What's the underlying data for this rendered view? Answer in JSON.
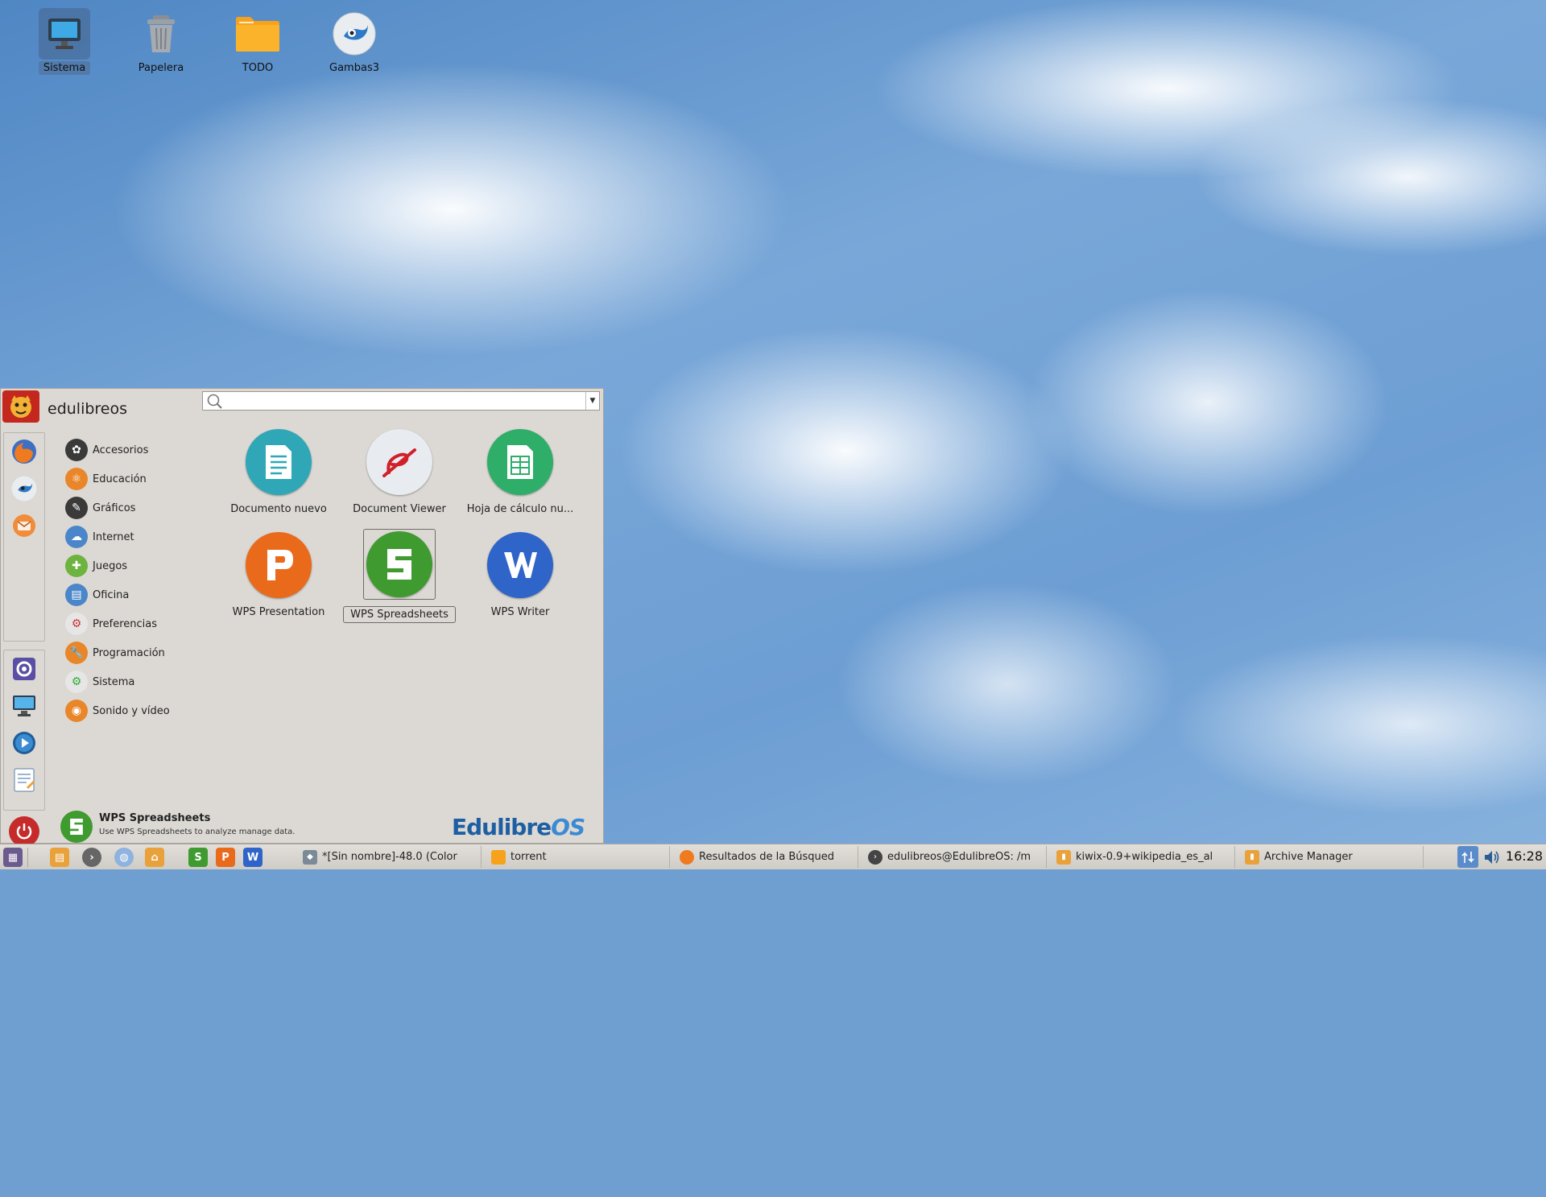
{
  "desktop": {
    "icons": [
      {
        "label": "Sistema",
        "icon": "computer-icon"
      },
      {
        "label": "Papelera",
        "icon": "trash-icon"
      },
      {
        "label": "TODO",
        "icon": "folder-icon"
      },
      {
        "label": "Gambas3",
        "icon": "gambas-icon"
      }
    ]
  },
  "menu": {
    "user": "edulibreos",
    "search": {
      "value": "",
      "placeholder": ""
    },
    "categories": [
      {
        "label": "Accesorios",
        "color": "#3a3a3a"
      },
      {
        "label": "Educación",
        "color": "#e9862a"
      },
      {
        "label": "Gráficos",
        "color": "#3a3a3a"
      },
      {
        "label": "Internet",
        "color": "#4a86c9"
      },
      {
        "label": "Juegos",
        "color": "#6cb33f"
      },
      {
        "label": "Oficina",
        "color": "#4a86c9"
      },
      {
        "label": "Preferencias",
        "color": "#e6e6e6"
      },
      {
        "label": "Programación",
        "color": "#e9862a"
      },
      {
        "label": "Sistema",
        "color": "#e6e6e6"
      },
      {
        "label": "Sonido y vídeo",
        "color": "#e9862a"
      }
    ],
    "apps": [
      {
        "label": "Documento nuevo",
        "color": "#2fa7b7",
        "icon": "document-icon"
      },
      {
        "label": "Document Viewer",
        "color": "#e8ecf1",
        "icon": "evince-icon"
      },
      {
        "label": "Hoja de cálculo nu...",
        "color": "#2fae6a",
        "icon": "spreadsheet-icon"
      },
      {
        "label": "WPS Presentation",
        "color": "#ea6a1c",
        "icon": "wps-presentation-icon"
      },
      {
        "label": "WPS Spreadsheets",
        "color": "#3f9a2f",
        "icon": "wps-spreadsheets-icon"
      },
      {
        "label": "WPS Writer",
        "color": "#2f64c8",
        "icon": "wps-writer-icon"
      }
    ],
    "description": {
      "title": "WPS Spreadsheets",
      "text": "Use WPS Spreadsheets to analyze manage data."
    },
    "brand": {
      "main": "Edulibre",
      "os": "OS"
    }
  },
  "taskbar": {
    "tasks": [
      {
        "label": "*[Sin nombre]-48.0 (Color",
        "icon": "gimp-icon"
      },
      {
        "label": "torrent",
        "icon": "folder-icon"
      },
      {
        "label": "Resultados de la Búsqued",
        "icon": "firefox-icon"
      },
      {
        "label": "edulibreos@EdulibreOS: /m",
        "icon": "terminal-icon"
      },
      {
        "label": "kiwix-0.9+wikipedia_es_al",
        "icon": "archive-icon"
      },
      {
        "label": "Archive Manager",
        "icon": "archive-icon"
      }
    ],
    "clock": "16:28"
  }
}
